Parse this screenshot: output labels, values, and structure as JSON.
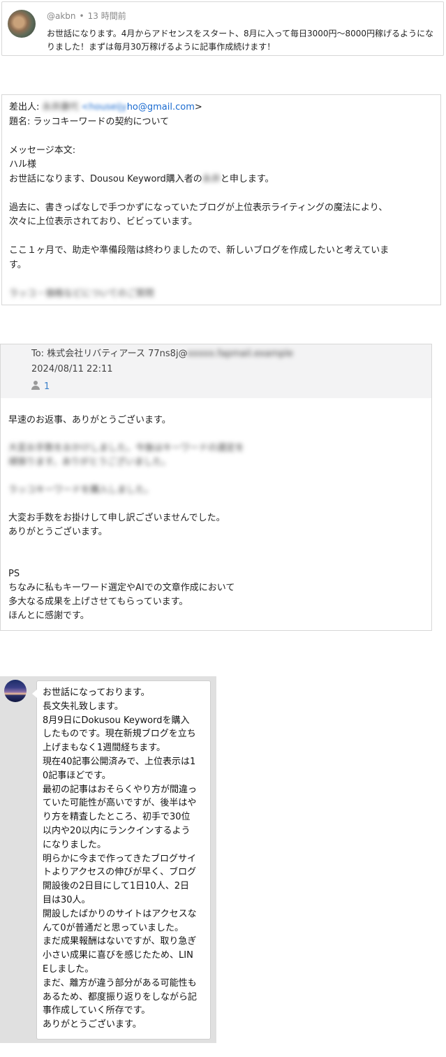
{
  "comment": {
    "username": "@akbn",
    "separator": "•",
    "time": "13 時間前",
    "text": "お世話になります。4月からアドセンスをスタート、8月に入って毎日3000円～8000円稼げるようになりました！まずは毎月30万稼げるように記事作成続けます！"
  },
  "email": {
    "from_label": "差出人: ",
    "from_name_blurred": "永井康代",
    "from_addr_blurred": " <houseijy",
    "from_addr_visible": "ho@gmail.com",
    "from_close": ">",
    "subject": "題名: ラッコキーワードの契約について",
    "body_label": "メッセージ本文:",
    "greeting": "ハル様",
    "intro_a": "お世話になります、Dousou Keyword購入者の",
    "intro_blurred": "永井",
    "intro_b": "と申します。",
    "para1": "過去に、書きっぱなしで手つかずになっていたブログが上位表示ライティングの魔法により、",
    "para1b": "次々に上位表示されており、ビビっています。",
    "para2": "ここ１ヶ月で、助走や準備段階は終わりましたので、新しいブログを作成したいと考えていま",
    "para2b": "す。",
    "para3_blurred": "ラッコ・価格などについてのご質問"
  },
  "reply": {
    "to_label": "To: 株式会社リバティアース 77ns8j@",
    "to_blurred": "xxxxx.fapmail.example",
    "date": "2024/08/11 22:11",
    "recipient_count": "1",
    "l1": "早速のお返事、ありがとうございます。",
    "b1": "大変お手数をおかけしました。今後はキーワードの選定を",
    "b2": "頑張ります。ありがとうございました。",
    "b3": "ラッコキーワードを購入しました。",
    "l2": "大変お手数をお掛けして申し訳ございませんでした。",
    "l3": "ありがとうございます。",
    "ps": "PS",
    "l4": "ちなみに私もキーワード選定やAIでの文章作成において",
    "l5": "多大なる成果を上げさせてもらっています。",
    "l6": "ほんとに感謝です。"
  },
  "chat": {
    "lines": [
      "お世話になっております。",
      "長文失礼致します。",
      "8月9日にDokusou Keywordを購入",
      "したものです。現在新規ブログを立ち",
      "上げまもなく1週間経ちます。",
      "現在40記事公開済みで、上位表示は1",
      "0記事ほどです。",
      "最初の記事はおそらくやり方が間違っ",
      "ていた可能性が高いですが、後半はや",
      "り方を精査したところ、初手で30位",
      "以内や20以内にランクインするよう",
      "になりました。",
      "明らかに今まで作ってきたブログサイ",
      "トよりアクセスの伸びが早く、ブログ",
      "開設後の2日目にして1日10人、2日",
      "目は30人。",
      "開設したばかりのサイトはアクセスな",
      "んて0が普通だと思っていました。",
      "まだ成果報酬はないですが、取り急ぎ",
      "小さい成果に喜びを感じたため、LIN",
      "Eしました。",
      "まだ、離方が違う部分がある可能性も",
      "あるため、都度振り返りをしながら記",
      "事作成していく所存です。",
      "ありがとうございます。"
    ]
  }
}
